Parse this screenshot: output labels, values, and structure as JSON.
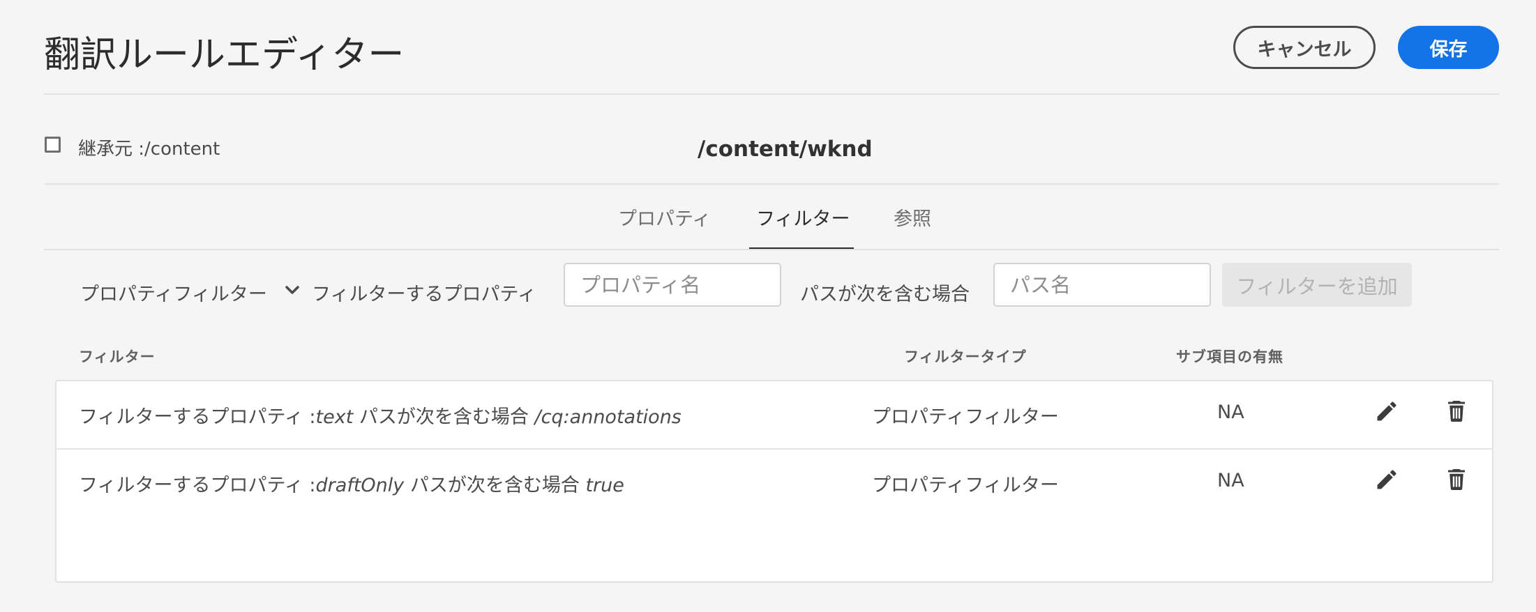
{
  "header": {
    "title": "翻訳ルールエディター",
    "cancel_label": "キャンセル",
    "save_label": "保存"
  },
  "inherit": {
    "checked": false,
    "label": "継承元 :/content"
  },
  "context_path": "/content/wknd",
  "tabs": [
    {
      "label": "プロパティ",
      "active": false
    },
    {
      "label": "フィルター",
      "active": true
    },
    {
      "label": "参照",
      "active": false
    }
  ],
  "filter_form": {
    "filter_type_select": "プロパティフィルター",
    "property_label": "フィルターするプロパティ",
    "property_placeholder": "プロパティ名",
    "property_value": "",
    "path_label": "パスが次を含む場合",
    "path_placeholder": "パス名",
    "path_value": "",
    "add_button_label": "フィルターを追加",
    "add_button_enabled": false
  },
  "table": {
    "columns": [
      "フィルター",
      "フィルタータイプ",
      "サブ項目の有無"
    ],
    "rows": [
      {
        "prop_prefix": "フィルターするプロパティ :",
        "prop_value": "text",
        "path_prefix": "パスが次を含む場合",
        "path_value": "/cq:annotations",
        "type": "プロパティフィルター",
        "children": "NA"
      },
      {
        "prop_prefix": "フィルターするプロパティ :",
        "prop_value": "draftOnly",
        "path_prefix": "パスが次を含む場合",
        "path_value": "true",
        "type": "プロパティフィルター",
        "children": "NA"
      }
    ]
  },
  "icons": {
    "edit": "pencil-icon",
    "delete": "trash-icon",
    "dropdown": "chevron-down-icon"
  },
  "colors": {
    "accent": "#1473e6",
    "background": "#f5f5f5"
  }
}
